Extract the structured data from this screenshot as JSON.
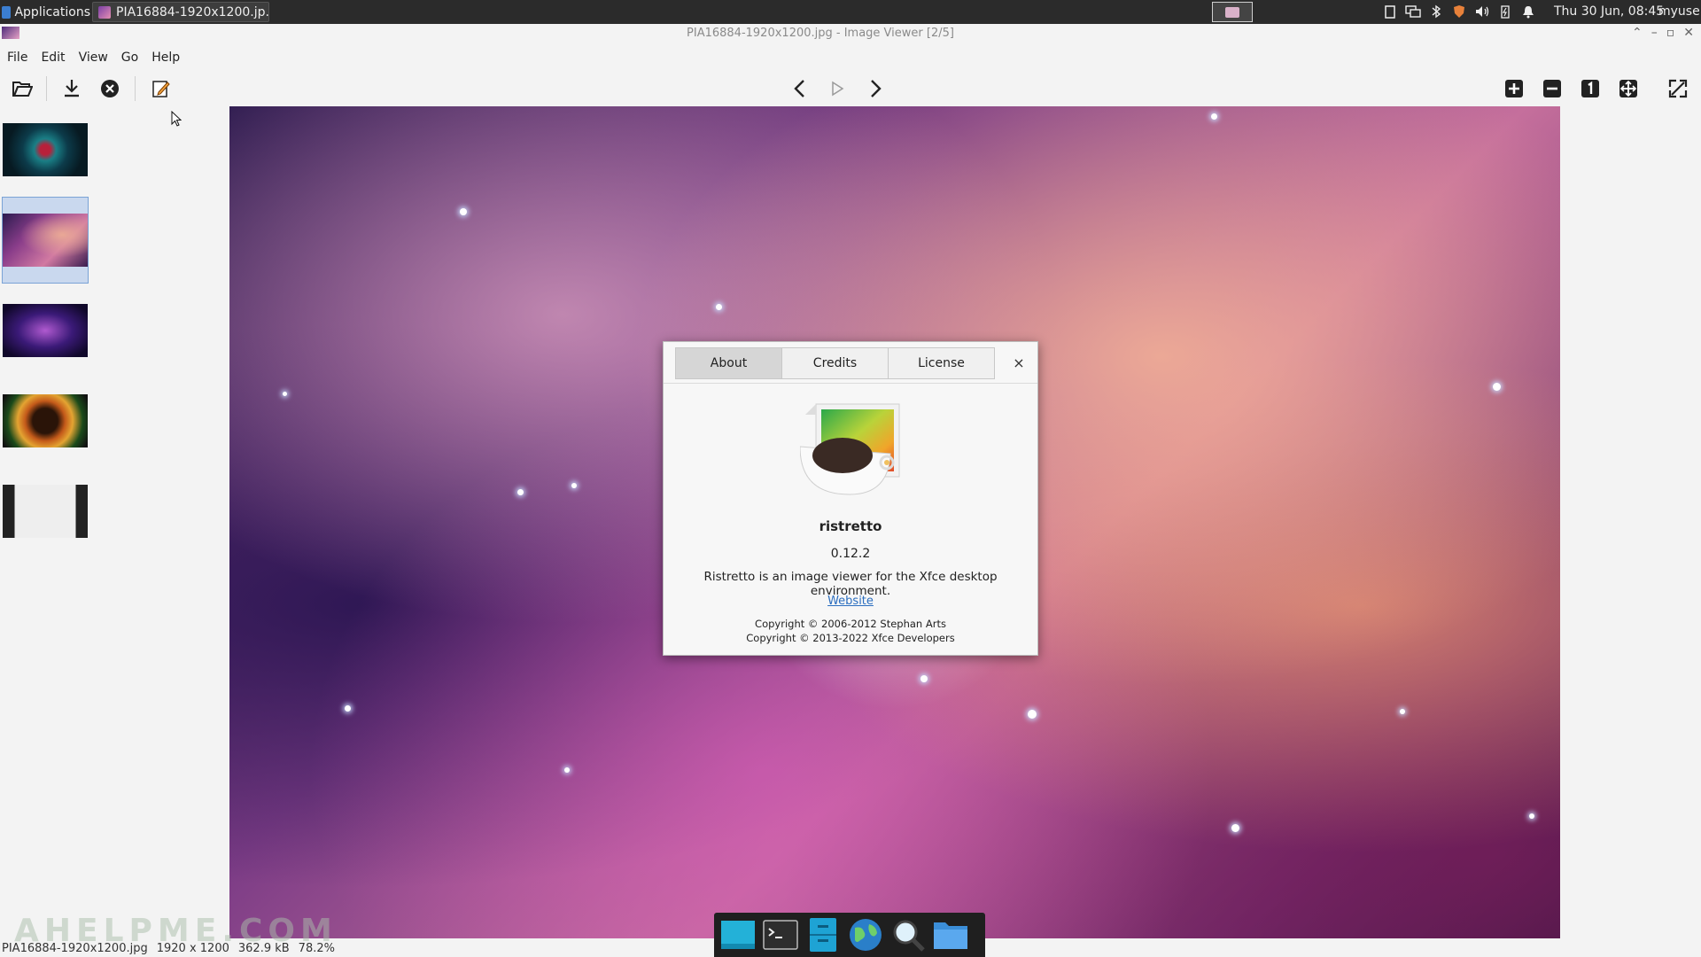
{
  "panel": {
    "applications_label": "Applications",
    "task_label": "PIA16884-1920x1200.jp...",
    "clock": "Thu 30 Jun, 08:45",
    "user": "myuser"
  },
  "window": {
    "title": "PIA16884-1920x1200.jpg - Image Viewer [2/5]"
  },
  "menubar": {
    "items": [
      "File",
      "Edit",
      "View",
      "Go",
      "Help"
    ]
  },
  "thumbnails": {
    "selected_index": 1,
    "count": 5
  },
  "dialog": {
    "tabs": [
      "About",
      "Credits",
      "License"
    ],
    "active_tab": "About",
    "close_label": "×",
    "app_name": "ristretto",
    "version": "0.12.2",
    "description": "Ristretto is an image viewer for the Xfce desktop environment.",
    "website_label": "Website",
    "copyright_1": "Copyright © 2006-2012 Stephan Arts",
    "copyright_2": "Copyright © 2013-2022 Xfce Developers"
  },
  "statusbar": {
    "filename": "PIA16884-1920x1200.jpg",
    "dimensions": "1920 x 1200",
    "filesize": "362.9 kB",
    "zoom": "78.2%"
  },
  "watermark": "AHELPME.COM",
  "colors": {
    "panel_bg": "#2b2b2b",
    "link": "#2a6dbf",
    "selection": "#c9d8ee"
  }
}
